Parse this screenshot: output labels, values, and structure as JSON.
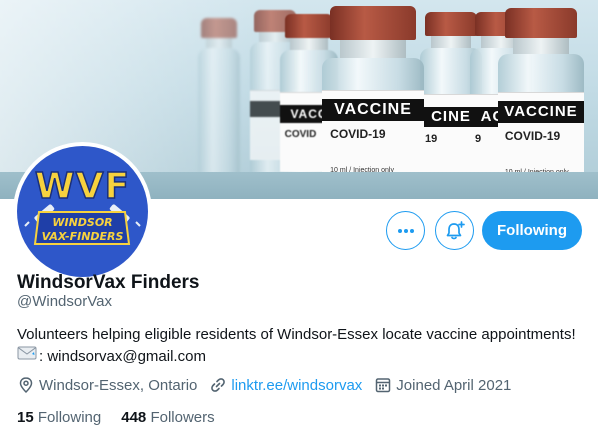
{
  "banner": {
    "vials": [
      {
        "brand": "VACCINE",
        "product": "COVID-19",
        "detail": "10 ml / Injection only"
      },
      {
        "brand": "VACCINE",
        "product": "COVID-19",
        "detail": "10 ml / Injection only"
      }
    ]
  },
  "avatar": {
    "initials": "WVF",
    "line1": "WINDSOR",
    "line2": "VAX-FINDERS"
  },
  "actions": {
    "following_label": "Following",
    "accent_color": "#1d9bf0"
  },
  "profile": {
    "name": "WindsorVax Finders",
    "handle": "@WindsorVax",
    "bio_line1": "Volunteers helping eligible residents of Windsor-Essex locate vaccine appointments!",
    "bio_line2": ": windsorvax@gmail.com",
    "location": "Windsor-Essex, Ontario",
    "link": "linktr.ee/windsorvax",
    "joined": "Joined April 2021"
  },
  "stats": {
    "following_count": "15",
    "following_label": "Following",
    "followers_count": "448",
    "followers_label": "Followers"
  },
  "icons": {
    "more": "more-horizontal-icon",
    "notify": "bell-plus-icon",
    "location": "location-pin-icon",
    "link": "link-icon",
    "calendar": "calendar-icon",
    "envelope": "envelope-emoji-icon"
  }
}
